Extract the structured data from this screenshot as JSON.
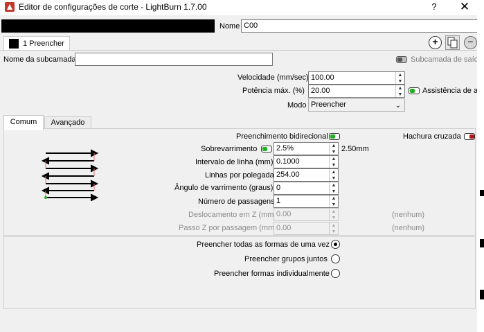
{
  "window": {
    "title": "Editor de configurações de corte - LightBurn 1.7.00",
    "help": "?",
    "close": "✕"
  },
  "name_field": {
    "label": "Nome",
    "value": "C00"
  },
  "layer_tab": {
    "label": "1 Preencher"
  },
  "sublayer": {
    "label": "Nome da subcamada",
    "value": "",
    "output_label": "Subcamada de saída"
  },
  "speed": {
    "label": "Velocidade (mm/sec)",
    "value": "100.00"
  },
  "power": {
    "label": "Potência máx. (%)",
    "value": "20.00",
    "air_assist_label": "Assistência de ar"
  },
  "mode": {
    "label": "Modo",
    "value": "Preencher"
  },
  "tabs": [
    {
      "label": "Comum"
    },
    {
      "label": "Avançado"
    }
  ],
  "common": {
    "bidirectional_label": "Preenchimento bidirecional",
    "crosshatch_label": "Hachura cruzada",
    "overscan": {
      "label": "Sobrevarrimento",
      "value": "2.5%",
      "computed": "2.50mm"
    },
    "line_interval": {
      "label": "Intervalo de linha (mm)",
      "value": "0.1000"
    },
    "lines_per_inch": {
      "label": "Linhas por polegada",
      "value": "254.00"
    },
    "scan_angle": {
      "label": "Ângulo de varrimento (graus)",
      "value": "0"
    },
    "passes": {
      "label": "Número de passagens",
      "value": "1"
    },
    "z_offset": {
      "label": "Deslocamento em Z (mm)",
      "value": "0.00",
      "note": "(nenhum)"
    },
    "z_step": {
      "label": "Passo Z por passagem (mm)",
      "value": "0.00",
      "note": "(nenhum)"
    },
    "fill_options": [
      {
        "label": "Preencher todas as formas de uma vez",
        "selected": true
      },
      {
        "label": "Preencher grupos juntos",
        "selected": false
      },
      {
        "label": "Preencher formas individualmente",
        "selected": false
      }
    ]
  },
  "colors": {
    "toggle_on": "#22b022",
    "toggle_off": "#b01616",
    "accent_icon": "#c0392b"
  }
}
